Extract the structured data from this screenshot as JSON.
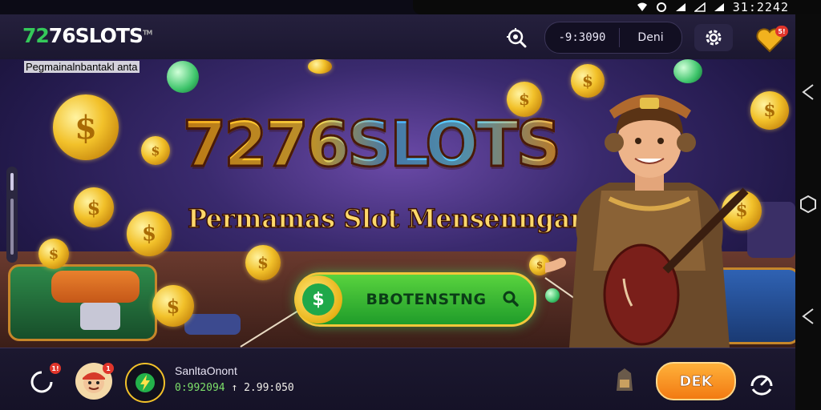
{
  "status_bar": {
    "time": "31:2242"
  },
  "header": {
    "logo_mark": "72",
    "logo_text": "76SLOTS",
    "logo_tm": "TM",
    "subtitle": "Pegmainalnbantakl anta",
    "balance": "-9:3090",
    "username": "Deni",
    "notification_badge": "5!"
  },
  "banner": {
    "title": "7276SLOTS",
    "tagline": "Permamas Slot Mensenngan",
    "cta_symbol": "$",
    "cta_label": "BBOTENSTNG"
  },
  "bottom_bar": {
    "left_badge": "1!",
    "avatar_badge": "1",
    "ticker_name": "SanltaOnont",
    "ticker_value_a": "0:992094",
    "ticker_sep": "↑",
    "ticker_value_b": "2.99:050",
    "go_label": "DEK"
  },
  "colors": {
    "accent_green": "#35c95a",
    "cta_green": "#1f9c2a",
    "go_orange": "#f27a12",
    "header_bg": "#1b1730",
    "badge_red": "#e0352b"
  },
  "icons": {
    "header": [
      "search-icon",
      "gear-icon",
      "heart-icon"
    ],
    "bottom": [
      "refresh-icon",
      "avatar",
      "lightning-icon",
      "treasure-icon",
      "speedometer-icon"
    ],
    "system": [
      "back-icon",
      "home-icon",
      "recents-icon"
    ]
  }
}
